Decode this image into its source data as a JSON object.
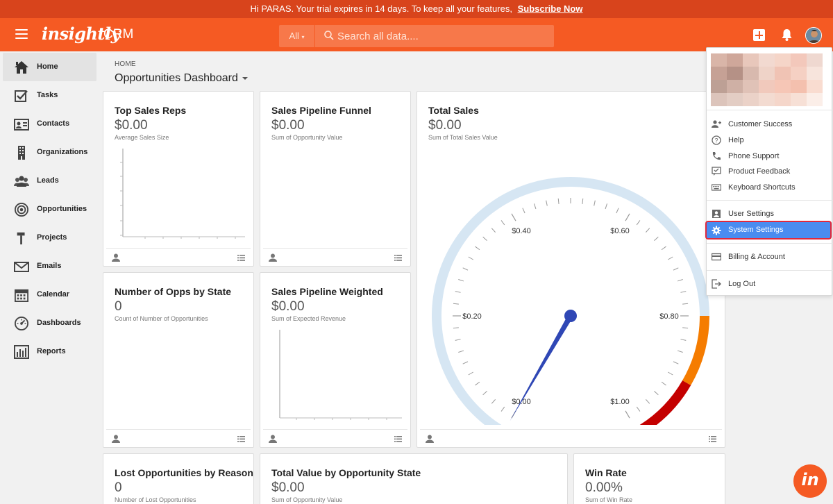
{
  "banner": {
    "text": "Hi PARAS. Your trial expires in 14 days. To keep all your features,",
    "link": "Subscribe Now"
  },
  "topbar": {
    "logo": "insightly",
    "product": "CRM",
    "search_scope": "All",
    "search_placeholder": "Search all data...."
  },
  "sidebar": {
    "items": [
      {
        "label": "Home",
        "icon": "home-icon",
        "active": true
      },
      {
        "label": "Tasks",
        "icon": "tasks-checkbox-icon"
      },
      {
        "label": "Contacts",
        "icon": "contacts-card-icon"
      },
      {
        "label": "Organizations",
        "icon": "building-icon"
      },
      {
        "label": "Leads",
        "icon": "people-icon"
      },
      {
        "label": "Opportunities",
        "icon": "target-icon"
      },
      {
        "label": "Projects",
        "icon": "hammer-icon"
      },
      {
        "label": "Emails",
        "icon": "envelope-icon"
      },
      {
        "label": "Calendar",
        "icon": "calendar-icon"
      },
      {
        "label": "Dashboards",
        "icon": "gauge-icon"
      },
      {
        "label": "Reports",
        "icon": "bar-chart-icon"
      }
    ]
  },
  "main": {
    "breadcrumb": "HOME",
    "title": "Opportunities Dashboard"
  },
  "cards": {
    "top_sales_reps": {
      "title": "Top Sales Reps",
      "value": "$0.00",
      "subtitle": "Average Sales Size"
    },
    "pipeline_funnel": {
      "title": "Sales Pipeline Funnel",
      "value": "$0.00",
      "subtitle": "Sum of Opportunity Value"
    },
    "total_sales": {
      "title": "Total Sales",
      "value": "$0.00",
      "subtitle": "Sum of Total Sales Value"
    },
    "opps_by_state": {
      "title": "Number of Opps by State",
      "value": "0",
      "subtitle": "Count of Number of Opportunities"
    },
    "pipeline_weighted": {
      "title": "Sales Pipeline Weighted",
      "value": "$0.00",
      "subtitle": "Sum of Expected Revenue"
    },
    "lost_opps": {
      "title": "Lost Opportunities by Reason",
      "value": "0",
      "subtitle": "Number of Lost Opportunities"
    },
    "value_by_state": {
      "title": "Total Value by Opportunity State",
      "value": "$0.00",
      "subtitle": "Sum of Opportunity Value"
    },
    "win_rate": {
      "title": "Win Rate",
      "value": "0.00%",
      "subtitle": "Sum of Win Rate"
    }
  },
  "chart_data": {
    "type": "gauge",
    "min": 0,
    "max": 1.0,
    "value": 0,
    "tick_labels": [
      "$0.00",
      "$0.20",
      "$0.40",
      "$0.60",
      "$0.80",
      "$1.00"
    ],
    "tick_values": [
      0,
      0.2,
      0.4,
      0.6,
      0.8,
      1.0
    ],
    "bands": [
      {
        "from": 0,
        "to": 0.8,
        "color": "#d6e6f3"
      },
      {
        "from": 0.8,
        "to": 0.9,
        "color": "#f57c00"
      },
      {
        "from": 0.9,
        "to": 1.0,
        "color": "#c40000"
      }
    ],
    "needle_color": "#2f47b5"
  },
  "user_menu": {
    "items_group1": [
      {
        "label": "Customer Success",
        "icon": "person-add-icon"
      },
      {
        "label": "Help",
        "icon": "help-circle-icon"
      },
      {
        "label": "Phone Support",
        "icon": "phone-icon"
      },
      {
        "label": "Product Feedback",
        "icon": "feedback-icon"
      },
      {
        "label": "Keyboard Shortcuts",
        "icon": "keyboard-icon"
      }
    ],
    "items_group2": [
      {
        "label": "User Settings",
        "icon": "user-settings-icon"
      },
      {
        "label": "System Settings",
        "icon": "gear-icon",
        "selected": true
      }
    ],
    "billing": {
      "label": "Billing & Account",
      "icon": "credit-card-icon"
    },
    "logout": {
      "label": "Log Out",
      "icon": "logout-icon"
    }
  },
  "colors": {
    "brand": "#f55a23",
    "banner": "#d8441c",
    "selected": "#4a8cf0",
    "highlight_border": "#e0283c"
  }
}
